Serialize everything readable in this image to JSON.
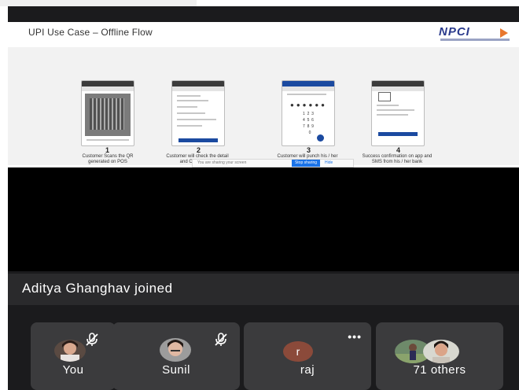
{
  "slide": {
    "title": "UPI Use Case – Offline Flow",
    "logo_text": "NPCI",
    "steps": [
      {
        "num": "1",
        "caption": "Customer Scans the QR generated on POS"
      },
      {
        "num": "2",
        "caption": "Customer will check the detail and Confirm Pay"
      },
      {
        "num": "3",
        "caption": "Customer will punch his / her UPIN PIN"
      },
      {
        "num": "4",
        "caption": "Success confirmation on app and SMS from his / her bank"
      }
    ],
    "share_bar": {
      "message": "You are sharing your screen",
      "stop_label": "Stop sharing",
      "hide_label": "Hide"
    }
  },
  "meeting": {
    "toast": "Aditya Ghanghav joined",
    "participants": [
      {
        "name": "You",
        "muted": true
      },
      {
        "name": "Sunil",
        "muted": true
      },
      {
        "name": "raj",
        "initial": "r",
        "more": "•••",
        "avatar_color": "#8b4a3a"
      },
      {
        "name": "71 others"
      }
    ]
  },
  "colors": {
    "background": "#1b1b1d",
    "tile": "#3b3b3d",
    "accent": "#1a73e8"
  }
}
